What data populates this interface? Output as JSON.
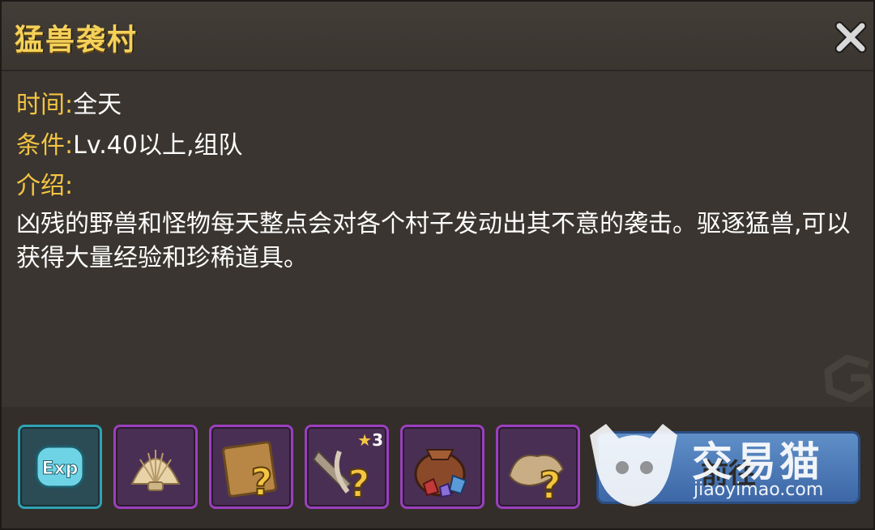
{
  "title": "猛兽袭村",
  "info": {
    "time_label": "时间:",
    "time_value": "全天",
    "cond_label": "条件:",
    "cond_value": "Lv.40以上,组队",
    "intro_label": "介绍:"
  },
  "description": "凶残的野兽和怪物每天整点会对各个村子发动出其不意的袭击。驱逐猛兽,可以获得大量经验和珍稀道具。",
  "rewards": [
    {
      "icon": "exp-icon",
      "label": "Exp"
    },
    {
      "icon": "shell-icon"
    },
    {
      "icon": "mystery-scroll-icon"
    },
    {
      "icon": "mystery-weapon-icon",
      "badge": "3"
    },
    {
      "icon": "gem-bag-icon"
    },
    {
      "icon": "mystery-relic-icon"
    }
  ],
  "goto_button": "前往",
  "watermark": {
    "text": "交易猫",
    "url": "jiaoyimao.com"
  },
  "colors": {
    "title": "#f4d25a",
    "label": "#f4c542",
    "panel": "#3a3530",
    "button": "#4f7fc0"
  }
}
